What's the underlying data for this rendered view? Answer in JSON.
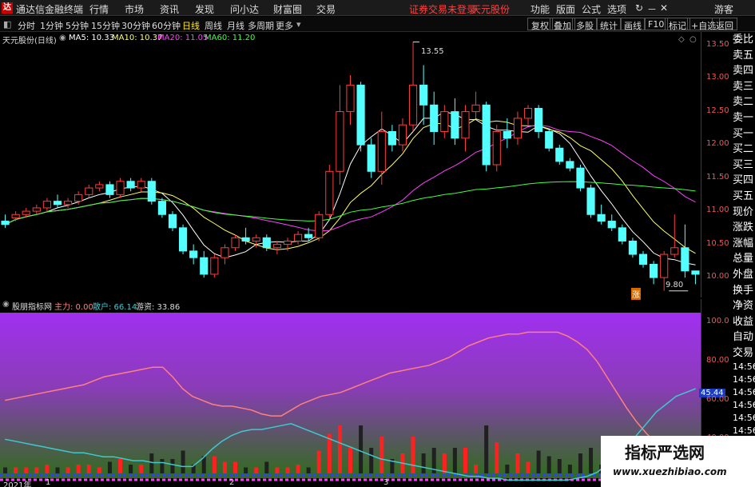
{
  "menubar": {
    "app_title": "通达信金融终端",
    "items": [
      "行情",
      "市场",
      "资讯",
      "发现",
      "问小达",
      "财富圈",
      "交易"
    ],
    "login_status": "证券交易未登录",
    "stock": "天元股份",
    "right_items": [
      "功能",
      "版面",
      "公式",
      "选项"
    ],
    "guest": "游客"
  },
  "toolbar": {
    "periods": [
      "分时",
      "1分钟",
      "5分钟",
      "15分钟",
      "30分钟",
      "60分钟",
      "日线",
      "周线",
      "月线",
      "多周期",
      "更多"
    ],
    "active_period": "日线",
    "buttons": [
      "复权",
      "叠加",
      "多股",
      "统计",
      "画线",
      "F10",
      "标记",
      "+自选",
      "返回"
    ]
  },
  "kline": {
    "title": "天元股份(日线)",
    "ma": [
      {
        "label": "MA5: 10.33",
        "color": "#ffffff"
      },
      {
        "label": "MA10: 10.37",
        "color": "#ffff60"
      },
      {
        "label": "MA20: 11.05",
        "color": "#ff40ff"
      },
      {
        "label": "MA60: 11.20",
        "color": "#40ff40"
      }
    ],
    "price_ticks": [
      "13.50",
      "13.00",
      "12.50",
      "12.00",
      "11.50",
      "11.00",
      "10.50",
      "10.00"
    ],
    "high_label": "13.55",
    "low_label": "9.80",
    "badge": "涨"
  },
  "indicator": {
    "name": "股朋指标网",
    "main_label": "主力: 0.00",
    "retail_label": "散户: 66.14",
    "hot_label": "游资: 33.86",
    "ticks": [
      "100.0",
      "80.00",
      "60.00",
      "40.00"
    ],
    "cursor_value": "45.44",
    "year_label": "2021年",
    "month_labels": [
      "1",
      "2",
      "3"
    ]
  },
  "sidebar": {
    "items": [
      "委比",
      "卖五",
      "卖四",
      "卖三",
      "卖二",
      "卖一",
      "买一",
      "买二",
      "买三",
      "买四",
      "买五",
      "现价",
      "涨跌",
      "涨幅",
      "总量",
      "外盘",
      "换手",
      "净资",
      "收益",
      "自动",
      "交易",
      "14:56",
      "14:56",
      "14:56",
      "14:56",
      "14:56",
      "14:56",
      "14:56",
      "14:56",
      "14:56"
    ]
  },
  "watermark": {
    "title": "指标严选网",
    "url": "www.xuezhibiao.com"
  },
  "chart_data": [
    {
      "type": "candlestick",
      "title": "天元股份(日线)",
      "ylim": [
        9.7,
        13.7
      ],
      "candles": [
        [
          10.85,
          10.95,
          10.75,
          10.8
        ],
        [
          10.9,
          11.0,
          10.85,
          10.95
        ],
        [
          10.95,
          11.05,
          10.9,
          11.0
        ],
        [
          11.0,
          11.1,
          10.95,
          11.05
        ],
        [
          11.05,
          11.2,
          11.0,
          11.15
        ],
        [
          11.15,
          11.25,
          11.05,
          11.1
        ],
        [
          11.1,
          11.2,
          11.05,
          11.15
        ],
        [
          11.15,
          11.3,
          11.1,
          11.25
        ],
        [
          11.25,
          11.4,
          11.2,
          11.35
        ],
        [
          11.35,
          11.45,
          11.3,
          11.4
        ],
        [
          11.4,
          11.45,
          11.2,
          11.25
        ],
        [
          11.25,
          11.5,
          11.2,
          11.45
        ],
        [
          11.45,
          11.5,
          11.3,
          11.35
        ],
        [
          11.35,
          11.5,
          11.3,
          11.45
        ],
        [
          11.45,
          11.5,
          11.1,
          11.15
        ],
        [
          11.15,
          11.2,
          10.9,
          10.95
        ],
        [
          10.95,
          11.0,
          10.7,
          10.75
        ],
        [
          10.75,
          10.8,
          10.35,
          10.4
        ],
        [
          10.4,
          10.5,
          10.2,
          10.3
        ],
        [
          10.3,
          10.4,
          10.0,
          10.05
        ],
        [
          10.05,
          10.35,
          10.0,
          10.3
        ],
        [
          10.3,
          10.5,
          10.2,
          10.45
        ],
        [
          10.45,
          10.65,
          10.4,
          10.6
        ],
        [
          10.6,
          10.75,
          10.5,
          10.55
        ],
        [
          10.55,
          10.65,
          10.45,
          10.6
        ],
        [
          10.6,
          10.65,
          10.4,
          10.45
        ],
        [
          10.45,
          10.55,
          10.35,
          10.5
        ],
        [
          10.5,
          10.6,
          10.4,
          10.55
        ],
        [
          10.55,
          10.7,
          10.5,
          10.65
        ],
        [
          10.65,
          10.75,
          10.55,
          10.6
        ],
        [
          10.6,
          11.0,
          10.55,
          10.95
        ],
        [
          10.95,
          11.7,
          10.9,
          11.6
        ],
        [
          11.6,
          12.9,
          11.4,
          12.5
        ],
        [
          12.5,
          13.05,
          12.3,
          12.9
        ],
        [
          12.9,
          12.95,
          11.9,
          12.0
        ],
        [
          12.0,
          12.1,
          11.5,
          11.6
        ],
        [
          11.6,
          12.5,
          11.4,
          12.2
        ],
        [
          12.2,
          12.3,
          11.9,
          12.0
        ],
        [
          12.0,
          12.4,
          11.9,
          12.3
        ],
        [
          12.3,
          13.55,
          12.2,
          12.9
        ],
        [
          12.9,
          13.2,
          12.3,
          12.6
        ],
        [
          12.6,
          12.8,
          12.0,
          12.2
        ],
        [
          12.2,
          12.6,
          12.1,
          12.5
        ],
        [
          12.5,
          12.7,
          12.0,
          12.1
        ],
        [
          12.1,
          12.6,
          11.9,
          12.5
        ],
        [
          12.5,
          12.8,
          12.4,
          12.6
        ],
        [
          12.6,
          12.65,
          11.6,
          11.7
        ],
        [
          11.7,
          12.3,
          11.6,
          12.2
        ],
        [
          12.2,
          12.4,
          11.95,
          12.1
        ],
        [
          12.1,
          12.5,
          12.0,
          12.4
        ],
        [
          12.4,
          12.6,
          12.3,
          12.55
        ],
        [
          12.55,
          12.6,
          12.1,
          12.2
        ],
        [
          12.2,
          12.25,
          11.9,
          11.95
        ],
        [
          11.95,
          12.0,
          11.7,
          11.75
        ],
        [
          11.75,
          11.8,
          11.6,
          11.65
        ],
        [
          11.65,
          11.7,
          11.3,
          11.35
        ],
        [
          11.35,
          11.4,
          10.9,
          10.95
        ],
        [
          10.95,
          11.1,
          10.8,
          10.85
        ],
        [
          10.85,
          10.95,
          10.7,
          10.75
        ],
        [
          10.75,
          10.8,
          10.5,
          10.55
        ],
        [
          10.55,
          10.6,
          10.3,
          10.35
        ],
        [
          10.35,
          10.4,
          10.15,
          10.2
        ],
        [
          10.2,
          10.25,
          9.9,
          10.0
        ],
        [
          10.0,
          10.4,
          9.8,
          10.35
        ],
        [
          10.35,
          10.95,
          10.3,
          10.45
        ],
        [
          10.45,
          10.8,
          10.0,
          10.1
        ],
        [
          10.1,
          10.1,
          9.9,
          10.05
        ]
      ]
    },
    {
      "type": "line",
      "title": "股朋指标网",
      "ylim": [
        20,
        105
      ],
      "series": [
        {
          "name": "主力",
          "color": "#ff8080",
          "values": [
            60,
            61,
            62,
            63,
            64,
            65,
            66,
            67,
            68,
            70,
            72,
            73,
            74,
            75,
            76,
            77,
            77,
            72,
            66,
            62,
            60,
            58,
            57,
            57,
            56,
            55,
            53,
            52,
            52,
            55,
            58,
            60,
            62,
            63,
            64,
            66,
            68,
            70,
            72,
            74,
            75,
            76,
            77,
            78,
            80,
            82,
            85,
            88,
            90,
            92,
            93,
            94,
            94,
            95,
            95,
            95,
            95,
            93,
            90,
            86,
            80,
            72,
            64,
            56,
            49,
            43,
            38,
            36,
            35,
            34,
            34
          ]
        },
        {
          "name": "散户",
          "color": "#40c8d0",
          "values": [
            40,
            39,
            38,
            37,
            36,
            35,
            34,
            33,
            33,
            32,
            31,
            31,
            30,
            29,
            29,
            28,
            28,
            27,
            26,
            26,
            30,
            35,
            39,
            42,
            44,
            45,
            45,
            46,
            47,
            48,
            46,
            44,
            42,
            40,
            38,
            36,
            34,
            32,
            30,
            29,
            28,
            27,
            26,
            25,
            24,
            23,
            22,
            21,
            21,
            20,
            20,
            19,
            19,
            19,
            19,
            19,
            19,
            19,
            20,
            21,
            23,
            27,
            31,
            36,
            42,
            48,
            54,
            58,
            62,
            64,
            66
          ]
        }
      ]
    }
  ]
}
